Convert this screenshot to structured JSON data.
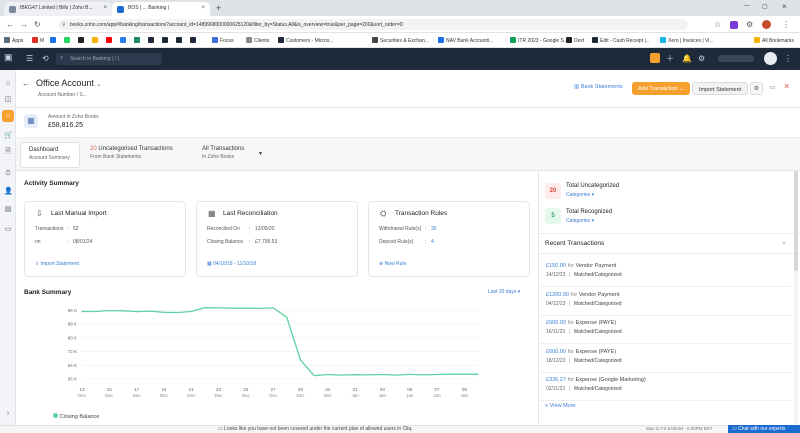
{
  "browser": {
    "tabs": [
      "IBKG47 Limited | Bills | Zoho B...",
      "BOS | ... Banking |",
      ""
    ],
    "new_tab": "+",
    "url": "books.zoho.com/app#/banking/transactions?account_id=1489968000000625120&filter_by=Status.All&is_overview=true&per_page=200&sort_order=D",
    "bookmarks": [
      "Apps",
      "M",
      "",
      "",
      "",
      "",
      "",
      "",
      "",
      "",
      "",
      "",
      "Focus",
      "Clients",
      "Customers - Micros...",
      "Securities & Exchan...",
      "NAV Bank Accounti...",
      "ITR 2023 - Google S...",
      "Dext",
      "Edit - Cash Receipt |...",
      "Xero | Invoices | Vi...",
      "All Bookmarks"
    ]
  },
  "appbar": {
    "search_placeholder": "Search in Banking ( / )"
  },
  "header": {
    "title": "Office Account",
    "subtitle": "Account Number / S...",
    "bank_statements": "Bank Statements",
    "add_transaction": "Add Transaction",
    "import_statement": "Import Statement"
  },
  "amount": {
    "label": "Amount in Zoho Books",
    "value": "£58,816.25"
  },
  "filters": {
    "dashboard": {
      "label": "Dashboard",
      "sub": "Account Summary"
    },
    "uncategorised": {
      "count": "20",
      "label": "Uncategorised Transactions",
      "sub": "From Bank Statements"
    },
    "all": {
      "label": "All Transactions",
      "sub": "In Zoho Books"
    }
  },
  "activity": {
    "heading": "Activity Summary",
    "manual_import": {
      "title": "Last Manual Import",
      "transactions_label": "Transactions",
      "transactions_value": "52",
      "on_label": "on",
      "on_value": "08/01/24",
      "link": "Import Statement"
    },
    "reconciliation": {
      "title": "Last Reconciliation",
      "reconciled_label": "Reconciled On",
      "reconciled_value": "12/05/20",
      "closing_label": "Closing Balance",
      "closing_value": "£7,799.53",
      "period": "04/10/18 - 11/10/18"
    },
    "rules": {
      "title": "Transaction Rules",
      "withdrawal_label": "Withdrawal Rule(s)",
      "withdrawal_value": "35",
      "deposit_label": "Deposit Rule(s)",
      "deposit_value": "4",
      "link": "New Rule"
    }
  },
  "bank_summary": {
    "heading": "Bank Summary",
    "range": "Last 30 days",
    "legend": "Closing Balance"
  },
  "chart_data": {
    "type": "line",
    "x": [
      "13 Dec",
      "14 Dec",
      "15 Dec",
      "16 Dec",
      "17 Dec",
      "18 Dec",
      "19 Dec",
      "20 Dec",
      "21 Dec",
      "22 Dec",
      "23 Dec",
      "24 Dec",
      "25 Dec",
      "26 Dec",
      "27 Dec",
      "28 Dec",
      "29 Dec",
      "30 Dec",
      "31 Dec",
      "01 Jan",
      "02 Jan",
      "03 Jan",
      "04 Jan",
      "05 Jan",
      "06 Jan",
      "07 Jan",
      "08 Jan",
      "09 Jan",
      "10 Jan",
      "11 Jan"
    ],
    "series": [
      {
        "name": "Closing Balance",
        "values": [
          95400,
          95400,
          95900,
          95800,
          95300,
          95600,
          94900,
          94800,
          95400,
          97600,
          97500,
          97300,
          97300,
          97200,
          97500,
          92000,
          67000,
          57900,
          58600,
          58300,
          58500,
          58400,
          58600,
          58300,
          58700,
          58400,
          58600,
          58800,
          58800,
          58800
        ]
      }
    ],
    "y_ticks": [
      "96 K",
      "88 K",
      "80 K",
      "72 K",
      "64 K",
      "56 K"
    ],
    "x_ticks": [
      {
        "d": "13",
        "m": "Dec"
      },
      {
        "d": "15",
        "m": "Dec"
      },
      {
        "d": "17",
        "m": "Dec"
      },
      {
        "d": "19",
        "m": "Dec"
      },
      {
        "d": "21",
        "m": "Dec"
      },
      {
        "d": "23",
        "m": "Dec"
      },
      {
        "d": "25",
        "m": "Dec"
      },
      {
        "d": "27",
        "m": "Dec"
      },
      {
        "d": "29",
        "m": "Dec"
      },
      {
        "d": "31",
        "m": "Dec"
      },
      {
        "d": "01",
        "m": "Jan"
      },
      {
        "d": "03",
        "m": "Jan"
      },
      {
        "d": "05",
        "m": "Jan"
      },
      {
        "d": "07",
        "m": "Jan"
      },
      {
        "d": "09",
        "m": "Jan"
      }
    ],
    "ylim": [
      56000,
      98000
    ],
    "color": "#5fd3a0"
  },
  "right": {
    "uncat": {
      "count": "20",
      "label": "Total Uncategorized",
      "link": "Categories"
    },
    "recog": {
      "count": "5",
      "label": "Total Recognized",
      "link": "Categories"
    },
    "recent_heading": "Recent Transactions",
    "transactions": [
      {
        "amount": "£150.00",
        "for": "for",
        "desc": "Vendor Payment",
        "date": "14/12/23",
        "status": "Matched/Categorized"
      },
      {
        "amount": "£1200.00",
        "for": "for",
        "desc": "Vendor Payment",
        "date": "04/12/23",
        "status": "Matched/Categorized"
      },
      {
        "amount": "£600.00",
        "for": "for",
        "desc": "Expense (PAYE)",
        "date": "16/11/23",
        "status": "Matched/Categorized"
      },
      {
        "amount": "£600.00",
        "for": "for",
        "desc": "Expense (PAYE)",
        "date": "18/12/23",
        "status": "Matched/Categorized"
      },
      {
        "amount": "£336.27",
        "for": "for",
        "desc": "Expense (Google Marketing)",
        "date": "02/11/23",
        "status": "Matched/Categorized"
      }
    ],
    "view_more": "+ View More"
  },
  "statusbar": {
    "notice": "Looks like you have not been covered under the current plan of allowed users in Cliq.",
    "hours": "Mon to Fri 9:00AM - 6:00PM BST",
    "chat": "Chat with our experts"
  }
}
